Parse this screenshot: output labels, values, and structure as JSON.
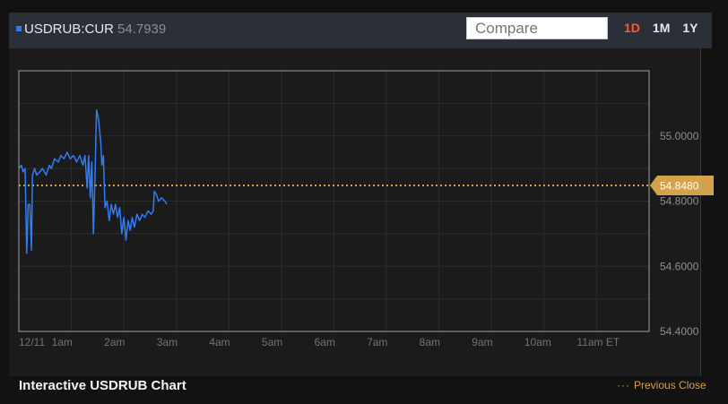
{
  "header": {
    "ticker": "USDRUB:CUR",
    "price": "54.7939",
    "compare_placeholder": "Compare",
    "ranges": [
      {
        "label": "1D",
        "active": true
      },
      {
        "label": "1M",
        "active": false
      },
      {
        "label": "1Y",
        "active": false
      }
    ]
  },
  "colors": {
    "series": "#2f7cf6",
    "previous_close": "#d4a24a",
    "active_range": "#ff5a1f"
  },
  "chart_data": {
    "type": "line",
    "title": "Interactive USDRUB Chart",
    "x_ticks": [
      "12/11",
      "1am",
      "2am",
      "3am",
      "4am",
      "5am",
      "6am",
      "7am",
      "8am",
      "9am",
      "10am",
      "11am ET"
    ],
    "x_range": [
      0,
      12
    ],
    "y_ticks": [
      "55.0000",
      "54.8000",
      "54.6000",
      "54.4000"
    ],
    "y_tick_values": [
      55.0,
      54.8,
      54.6,
      54.4
    ],
    "y_range": [
      54.4,
      55.2
    ],
    "grid": true,
    "previous_close": {
      "value": 54.848,
      "label": "54.8480",
      "legend": "Previous Close"
    },
    "series": [
      {
        "values": [
          [
            0.0,
            54.9
          ],
          [
            0.05,
            54.91
          ],
          [
            0.08,
            54.89
          ],
          [
            0.12,
            54.9
          ],
          [
            0.15,
            54.64
          ],
          [
            0.18,
            54.79
          ],
          [
            0.21,
            54.79
          ],
          [
            0.24,
            54.65
          ],
          [
            0.26,
            54.88
          ],
          [
            0.3,
            54.9
          ],
          [
            0.34,
            54.88
          ],
          [
            0.4,
            54.89
          ],
          [
            0.45,
            54.9
          ],
          [
            0.52,
            54.88
          ],
          [
            0.58,
            54.91
          ],
          [
            0.62,
            54.9
          ],
          [
            0.68,
            54.93
          ],
          [
            0.75,
            54.92
          ],
          [
            0.8,
            54.94
          ],
          [
            0.86,
            54.93
          ],
          [
            0.92,
            54.95
          ],
          [
            0.98,
            54.93
          ],
          [
            1.04,
            54.94
          ],
          [
            1.1,
            54.92
          ],
          [
            1.16,
            54.94
          ],
          [
            1.22,
            54.91
          ],
          [
            1.26,
            54.94
          ],
          [
            1.3,
            54.84
          ],
          [
            1.33,
            54.94
          ],
          [
            1.36,
            54.81
          ],
          [
            1.39,
            54.92
          ],
          [
            1.42,
            54.7
          ],
          [
            1.45,
            54.87
          ],
          [
            1.48,
            55.08
          ],
          [
            1.52,
            55.05
          ],
          [
            1.56,
            54.98
          ],
          [
            1.58,
            54.91
          ],
          [
            1.61,
            54.94
          ],
          [
            1.64,
            54.78
          ],
          [
            1.68,
            54.8
          ],
          [
            1.72,
            54.74
          ],
          [
            1.76,
            54.79
          ],
          [
            1.8,
            54.76
          ],
          [
            1.84,
            54.79
          ],
          [
            1.88,
            54.75
          ],
          [
            1.92,
            54.78
          ],
          [
            1.96,
            54.7
          ],
          [
            2.0,
            54.75
          ],
          [
            2.04,
            54.68
          ],
          [
            2.08,
            54.74
          ],
          [
            2.12,
            54.71
          ],
          [
            2.16,
            54.75
          ],
          [
            2.2,
            54.72
          ],
          [
            2.25,
            54.76
          ],
          [
            2.3,
            54.74
          ],
          [
            2.35,
            54.76
          ],
          [
            2.4,
            54.75
          ],
          [
            2.46,
            54.77
          ],
          [
            2.52,
            54.76
          ],
          [
            2.56,
            54.77
          ],
          [
            2.58,
            54.83
          ],
          [
            2.62,
            54.82
          ],
          [
            2.66,
            54.8
          ],
          [
            2.72,
            54.81
          ],
          [
            2.78,
            54.8
          ],
          [
            2.82,
            54.79
          ]
        ]
      }
    ]
  }
}
